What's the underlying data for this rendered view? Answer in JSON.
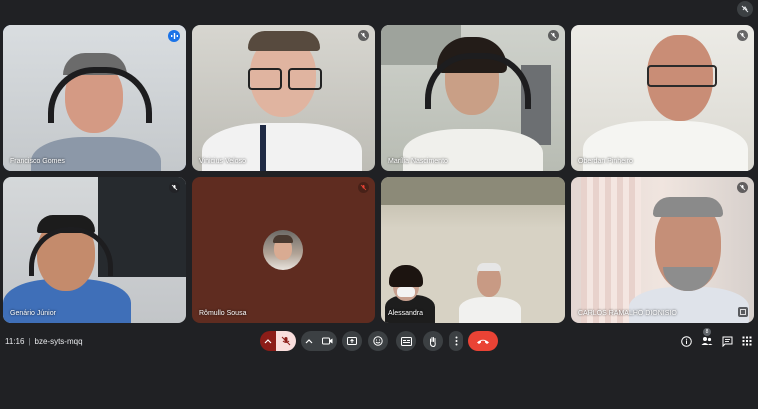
{
  "participants": [
    {
      "name": "Francisco Gomes",
      "status_icon": "speaking-indicator-icon"
    },
    {
      "name": "Vinicius Veloso",
      "status_icon": "mic-off-icon"
    },
    {
      "name": "Marília Nascimento",
      "status_icon": "mic-off-icon"
    },
    {
      "name": "Oberdan Pinheiro",
      "status_icon": "mic-off-icon"
    },
    {
      "name": "Genário Júnior",
      "status_icon": "mic-off-icon"
    },
    {
      "name": "Rômullo Sousa",
      "status_icon": "mic-off-icon"
    },
    {
      "name": "Alessandra",
      "status_icon": ""
    },
    {
      "name": "CARLOS RAMALHO DIONISIO",
      "status_icon": "mic-off-icon"
    }
  ],
  "meeting": {
    "time": "11:16",
    "code": "bze-syts-mqq"
  },
  "controls": {
    "left_group": [
      "chevron-up-icon",
      "mic-off-icon",
      "chevron-up-icon",
      "camera-icon",
      "present-icon",
      "emoji-icon",
      "captions-icon",
      "raise-hand-icon",
      "more-options-icon",
      "end-call-icon"
    ],
    "right_group": [
      "info-icon",
      "people-icon",
      "chat-icon",
      "activities-icon"
    ],
    "people_count": "8"
  },
  "colors": {
    "background": "#202124",
    "end_call": "#ea4335",
    "speaking": "#8ab4f8"
  }
}
